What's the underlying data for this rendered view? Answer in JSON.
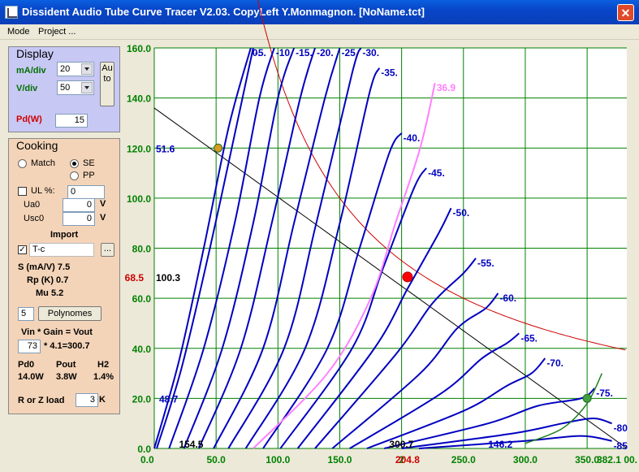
{
  "window": {
    "title": "Dissident Audio Tube Curve Tracer V2.03. CopyLeft Y.Monmagnon. [NoName.tct]",
    "close_glyph": "✕"
  },
  "menu": {
    "mode": "Mode",
    "project": "Project ..."
  },
  "display": {
    "title": "Display",
    "ma_div_label": "mA/div",
    "ma_div_value": "20",
    "v_div_label": "V/div",
    "v_div_value": "50",
    "auto_button": "Auto",
    "pd_label": "Pd(W)",
    "pd_value": "15"
  },
  "cooking": {
    "title": "Cooking",
    "match_label": "Match",
    "se_label": "SE",
    "pp_label": "PP",
    "ul_label": "UL  %:",
    "ul_value": "0",
    "ua0_label": "Ua0",
    "ua0_value": "0",
    "ua0_unit": "V",
    "usc0_label": "Usc0",
    "usc0_value": "0",
    "usc0_unit": "V",
    "import_label": "Import",
    "import_check": "✓",
    "import_value": "T-c",
    "browse_button": "...",
    "s_text": "S (mA/V)  7.5",
    "rp_text": "Rp (K)  0.7",
    "mu_text": "Mu    5.2",
    "poly_value": "5",
    "poly_button": "Polynomes",
    "gain_header": "Vin   * Gain = Vout",
    "vin_value": "73",
    "gain_text": "* 4.1=300.7",
    "pd0_label": "Pd0",
    "pout_label": "Pout",
    "h2_label": "H2",
    "pd0_value": "14.0W",
    "pout_value": "3.8W",
    "h2_value": "1.4%",
    "load_label": "R or Z load",
    "load_value": "3",
    "load_unit": "K"
  },
  "colors": {
    "grid": "#008000",
    "curves": "#0000C0",
    "loadline": "#000000",
    "hyperbola": "#CC0000",
    "pink_curve": "#FF80FF",
    "dark_green": "#208020"
  },
  "chart_data": {
    "type": "line",
    "xlim": [
      0,
      382.1
    ],
    "ylim": [
      0,
      160
    ],
    "x_ticks": [
      "0.0",
      "50.0",
      "100.0",
      "150.0",
      "2",
      "250.0",
      "300.0",
      "350.0",
      "382.1 00."
    ],
    "y_ticks": [
      "0.0",
      "20.0",
      "40.0",
      "60.0",
      "80.0",
      "100.0",
      "120.0",
      "140.0",
      "160.0"
    ],
    "x_tick_values": [
      0,
      50,
      100,
      150,
      200,
      250,
      300,
      350,
      382.1
    ],
    "y_tick_values": [
      0,
      20,
      40,
      60,
      80,
      100,
      120,
      140,
      160
    ],
    "x_highlight": "204.8",
    "x_highlight_value": 204.8,
    "y_highlight": "68.5",
    "y_highlight_value": 68.5,
    "grid": true,
    "series": [
      {
        "name": "0.",
        "values": [
          [
            0,
            0
          ],
          [
            20,
            35
          ],
          [
            40,
            80
          ],
          [
            60,
            128
          ],
          [
            78,
            160
          ]
        ]
      },
      {
        "name": "-5.",
        "values": [
          [
            2,
            0
          ],
          [
            22,
            32
          ],
          [
            45,
            80
          ],
          [
            67,
            130
          ],
          [
            80,
            160
          ]
        ]
      },
      {
        "name": "-10.",
        "values": [
          [
            12,
            0
          ],
          [
            40,
            40
          ],
          [
            65,
            90
          ],
          [
            85,
            140
          ],
          [
            97,
            160
          ]
        ]
      },
      {
        "name": "-15.",
        "values": [
          [
            24,
            0
          ],
          [
            55,
            40
          ],
          [
            80,
            90
          ],
          [
            100,
            140
          ],
          [
            113,
            160
          ]
        ]
      },
      {
        "name": "-20.",
        "values": [
          [
            36,
            0
          ],
          [
            70,
            40
          ],
          [
            95,
            90
          ],
          [
            118,
            140
          ],
          [
            130,
            160
          ]
        ]
      },
      {
        "name": "-25.",
        "values": [
          [
            48,
            0
          ],
          [
            88,
            40
          ],
          [
            113,
            90
          ],
          [
            138,
            140
          ],
          [
            150,
            160
          ]
        ]
      },
      {
        "name": "-30.",
        "values": [
          [
            60,
            0
          ],
          [
            105,
            40
          ],
          [
            131,
            90
          ],
          [
            160,
            150
          ],
          [
            167,
            160
          ]
        ]
      },
      {
        "name": "-35.",
        "values": [
          [
            74,
            0
          ],
          [
            122,
            40
          ],
          [
            150,
            90
          ],
          [
            174,
            142
          ],
          [
            182,
            152
          ]
        ]
      },
      {
        "name": "-40.",
        "values": [
          [
            88,
            0
          ],
          [
            140,
            40
          ],
          [
            166,
            80
          ],
          [
            190,
            118
          ],
          [
            200,
            126
          ]
        ]
      },
      {
        "name": "-45.",
        "values": [
          [
            102,
            0
          ],
          [
            160,
            40
          ],
          [
            185,
            72
          ],
          [
            210,
            104
          ],
          [
            220,
            112
          ]
        ]
      },
      {
        "name": "-50.",
        "values": [
          [
            116,
            0
          ],
          [
            178,
            40
          ],
          [
            205,
            64
          ],
          [
            230,
            86
          ],
          [
            240,
            96
          ]
        ]
      },
      {
        "name": "-55.",
        "values": [
          [
            130,
            0
          ],
          [
            196,
            38
          ],
          [
            225,
            58
          ],
          [
            250,
            70
          ],
          [
            260,
            76
          ]
        ]
      },
      {
        "name": "-60.",
        "values": [
          [
            144,
            0
          ],
          [
            215,
            30
          ],
          [
            245,
            48
          ],
          [
            268,
            56
          ],
          [
            278,
            62
          ]
        ]
      },
      {
        "name": "-65.",
        "values": [
          [
            158,
            0
          ],
          [
            232,
            22
          ],
          [
            265,
            36
          ],
          [
            285,
            42
          ],
          [
            295,
            46
          ]
        ]
      },
      {
        "name": "-70.",
        "values": [
          [
            172,
            0
          ],
          [
            250,
            15
          ],
          [
            285,
            25
          ],
          [
            305,
            30
          ],
          [
            316,
            36
          ]
        ]
      },
      {
        "name": "-75.",
        "values": [
          [
            186,
            0
          ],
          [
            270,
            10
          ],
          [
            310,
            17
          ],
          [
            345,
            20
          ],
          [
            356,
            24
          ]
        ]
      },
      {
        "name": "-80",
        "values": [
          [
            200,
            0
          ],
          [
            290,
            6
          ],
          [
            330,
            10
          ],
          [
            355,
            12
          ],
          [
            370,
            10
          ]
        ]
      },
      {
        "name": "-85",
        "values": [
          [
            214,
            0
          ],
          [
            300,
            3
          ],
          [
            345,
            5
          ],
          [
            370,
            3
          ]
        ]
      },
      {
        "name": "36.9",
        "values": [
          [
            80,
            0
          ],
          [
            140,
            30
          ],
          [
            175,
            60
          ],
          [
            195,
            90
          ],
          [
            215,
            120
          ],
          [
            227,
            146
          ]
        ]
      }
    ],
    "load_line": [
      [
        0,
        136
      ],
      [
        382.1,
        0
      ]
    ],
    "power_hyperbola_W": 15,
    "operating_point": {
      "x": 204.8,
      "y": 68.5
    },
    "upper_point": {
      "x": 51.6,
      "y": 120
    },
    "lower_point": {
      "x": 350,
      "y": 20
    },
    "annotations": {
      "left_ua": "51.6",
      "quiescent_ua": "100.3",
      "low_ia": "48.7",
      "bottom_left": "154.5",
      "bottom_mid": "300.7",
      "bottom_right": "146.2"
    }
  }
}
